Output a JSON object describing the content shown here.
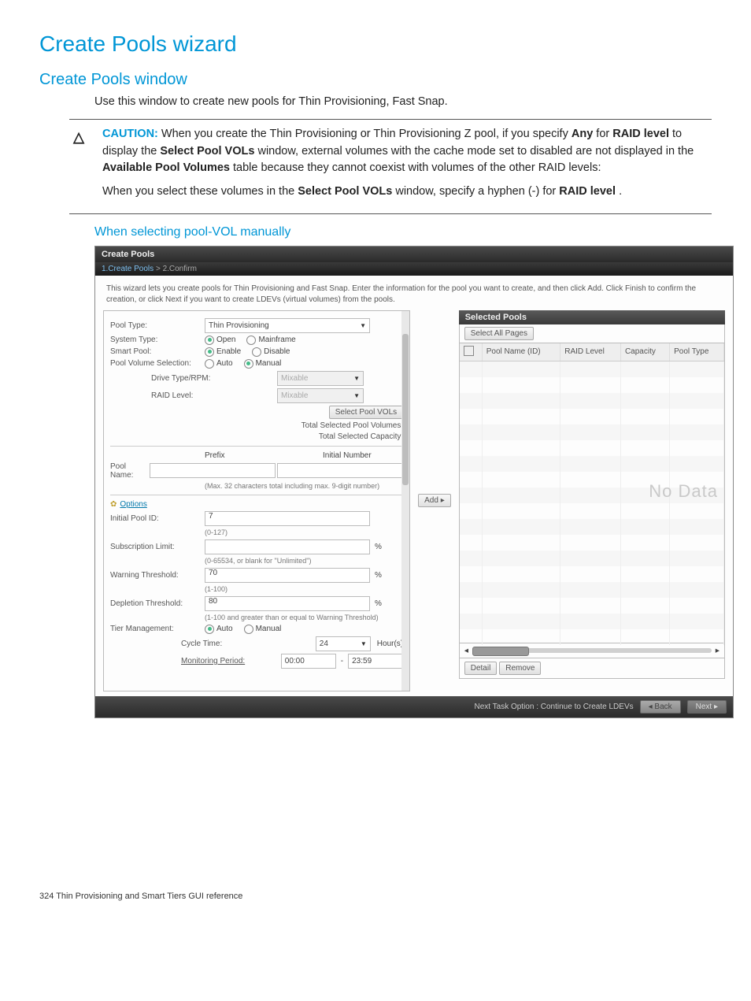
{
  "page": {
    "title": "Create Pools wizard",
    "subtitle": "Create Pools window",
    "intro": "Use this window to create new pools for Thin Provisioning, Fast Snap.",
    "section_manual": "When selecting pool-VOL manually",
    "footer": "324   Thin Provisioning and Smart Tiers GUI reference"
  },
  "caution": {
    "icon": "△",
    "label": "CAUTION:",
    "para1_prefix": "When you create the Thin Provisioning or Thin Provisioning Z pool, if you specify ",
    "any": "Any",
    "for_word": " for ",
    "raid_level": "RAID level",
    "display_word": " to display the ",
    "select_pool_vols": "Select Pool VOLs",
    "para1_mid": " window, external volumes with the cache mode set to disabled are not displayed in the ",
    "available_pool_volumes": "Available Pool Volumes",
    "para1_end": " table because they cannot coexist with volumes of the other RAID levels:",
    "para2_prefix": "When you select these volumes in the ",
    "para2_mid": " window, specify a hyphen (-) for ",
    "para2_end": "."
  },
  "wizard": {
    "title": "Create Pools",
    "steps": {
      "s1": "1.Create Pools",
      "sep": ">",
      "s2": "2.Confirm"
    },
    "desc": "This wizard lets you create pools for Thin Provisioning and Fast Snap. Enter the information for the pool you want to create, and then click Add. Click Finish to confirm the creation, or click Next if you want to create LDEVs (virtual volumes) from the pools.",
    "left": {
      "pool_type_label": "Pool Type:",
      "pool_type_value": "Thin Provisioning",
      "system_type_label": "System Type:",
      "system_type_open": "Open",
      "system_type_mainframe": "Mainframe",
      "smart_pool_label": "Smart Pool:",
      "smart_pool_enable": "Enable",
      "smart_pool_disable": "Disable",
      "pool_vol_sel_label": "Pool Volume Selection:",
      "pvs_auto": "Auto",
      "pvs_manual": "Manual",
      "drive_type_label": "Drive Type/RPM:",
      "mixable": "Mixable",
      "raid_level_label": "RAID Level:",
      "select_pool_vols_btn": "Select Pool VOLs",
      "total_sel_vol": "Total Selected Pool Volumes:",
      "total_sel_cap": "Total Selected Capacity:",
      "prefix": "Prefix",
      "initial_number": "Initial Number",
      "pool_name_label": "Pool Name:",
      "pool_name_hint": "(Max. 32 characters total including max. 9-digit number)",
      "options_link": "Options",
      "initial_pool_id_label": "Initial Pool ID:",
      "initial_pool_id_value": "7",
      "initial_pool_id_hint": "(0-127)",
      "sub_limit_label": "Subscription Limit:",
      "sub_limit_value": "",
      "sub_limit_unit": "%",
      "sub_limit_hint": "(0-65534, or blank for \"Unlimited\")",
      "warn_thresh_label": "Warning Threshold:",
      "warn_thresh_value": "70",
      "warn_thresh_unit": "%",
      "warn_thresh_hint": "(1-100)",
      "dep_thresh_label": "Depletion Threshold:",
      "dep_thresh_value": "80",
      "dep_thresh_unit": "%",
      "dep_thresh_hint": "(1-100 and greater than or equal to Warning Threshold)",
      "tier_mgmt_label": "Tier Management:",
      "tier_auto": "Auto",
      "tier_manual": "Manual",
      "cycle_time_label": "Cycle Time:",
      "cycle_time_value": "24",
      "cycle_time_unit": "Hour(s)",
      "monitoring_label": "Monitoring Period:",
      "monitoring_from": "00:00",
      "monitoring_sep": "-",
      "monitoring_to": "23:59"
    },
    "add_btn": "Add ▸",
    "right": {
      "title": "Selected Pools",
      "select_all_pages": "Select All Pages",
      "col_poolname": "Pool Name (ID)",
      "col_raid": "RAID Level",
      "col_cap": "Capacity",
      "col_ptype": "Pool Type",
      "no_data": "No Data",
      "detail_btn": "Detail",
      "remove_btn": "Remove"
    },
    "footer": {
      "next_task": "Next Task Option : Continue to Create LDEVs",
      "back": "◂ Back",
      "next": "Next ▸"
    }
  }
}
